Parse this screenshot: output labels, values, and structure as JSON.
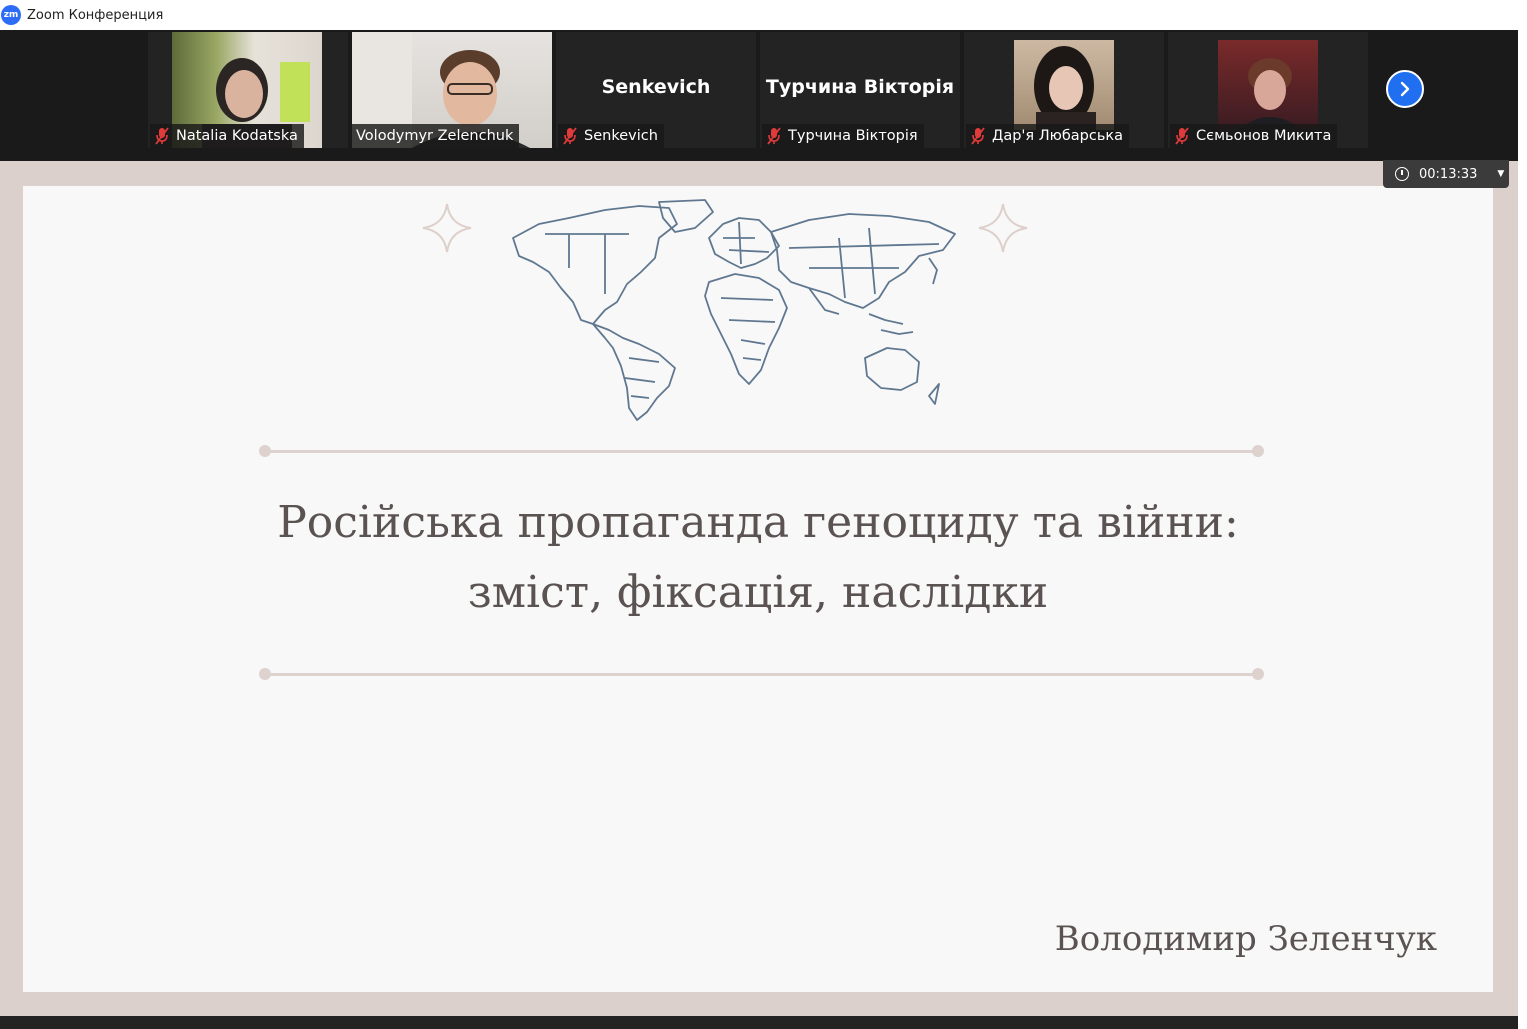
{
  "window": {
    "app_logo": "zm",
    "title": "Zoom Конференция"
  },
  "participants": [
    {
      "name": "Natalia Kodatska",
      "muted": true,
      "video": true,
      "active": false
    },
    {
      "name": "Volodymyr Zelenchuk",
      "muted": false,
      "video": true,
      "active": true
    },
    {
      "name": "Senkevich",
      "muted": true,
      "video": false,
      "display_name": "Senkevich"
    },
    {
      "name": "Турчина Вікторія",
      "muted": true,
      "video": false,
      "display_name": "Турчина Вікторія"
    },
    {
      "name": "Дар'я Любарська",
      "muted": true,
      "video": true
    },
    {
      "name": "Сємьонов Микита",
      "muted": true,
      "video": true
    }
  ],
  "controls": {
    "next_page_icon": "chevron-right-icon",
    "timer": "00:13:33"
  },
  "slide": {
    "title_line1": "Російська пропаганда геноциду та війни:",
    "title_line2": "зміст, фіксація, наслідки",
    "author": "Володимир Зеленчук",
    "decor": [
      "four-point-star-icon",
      "world-map-icon",
      "four-point-star-icon"
    ]
  },
  "colors": {
    "accent": "#1f6ff0",
    "active_speaker": "#9fd266",
    "muted_icon": "#e03a3a",
    "slide_frame": "#dcd0cc",
    "slide_text": "#5a5352",
    "map_stroke": "#5f7890"
  }
}
